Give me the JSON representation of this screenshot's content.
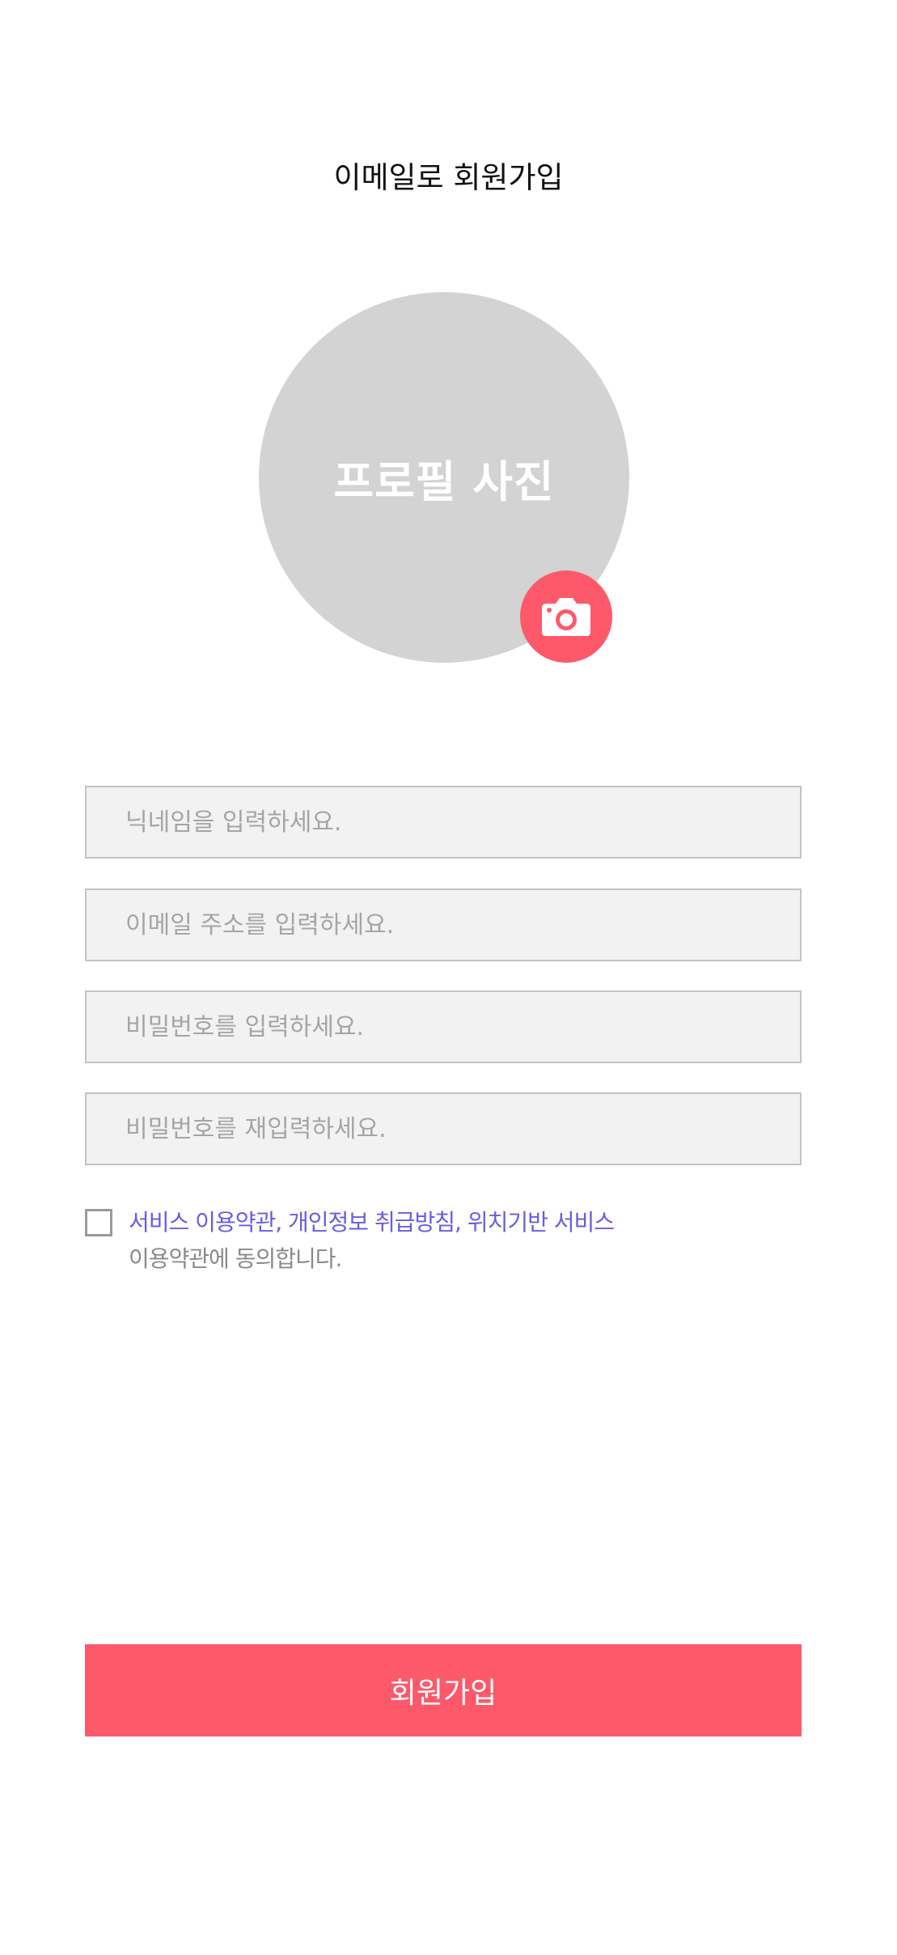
{
  "header": {
    "title": "이메일로 회원가입"
  },
  "profile": {
    "avatar_label": "프로필 사진",
    "camera_icon": "camera-icon"
  },
  "form": {
    "nickname": {
      "value": "",
      "placeholder": "닉네임을 입력하세요."
    },
    "email": {
      "value": "",
      "placeholder": "이메일 주소를 입력하세요."
    },
    "password": {
      "value": "",
      "placeholder": "비밀번호를 입력하세요."
    },
    "password_confirm": {
      "value": "",
      "placeholder": "비밀번호를 재입력하세요."
    }
  },
  "agreement": {
    "checked": false,
    "link_text": "서비스 이용약관, 개인정보 취급방침, 위치기반 서비스",
    "suffix_text": "이용약관에 동의합니다."
  },
  "actions": {
    "signup_label": "회원가입"
  },
  "colors": {
    "accent": "#fd596b",
    "link": "#6a5ce3",
    "avatar_bg": "#d3d3d3",
    "field_bg": "#f2f2f2"
  }
}
